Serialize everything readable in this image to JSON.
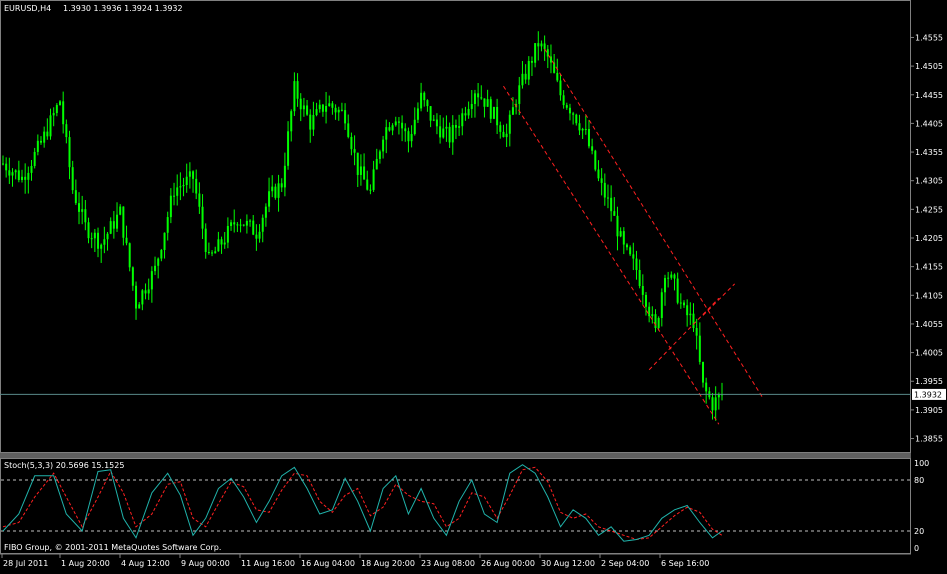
{
  "header": {
    "symbol": "EURUSD,H4",
    "ohlc": "1.3930 1.3936 1.3924 1.3932"
  },
  "indicator": {
    "label": "Stoch(5,3,3) 20.5696 15.1525",
    "levels_labels": [
      "100",
      "80",
      "20",
      "0"
    ],
    "main_color": "#20b2aa",
    "signal_color": "#ff2020"
  },
  "copyright": "FIBO Group, © 2001-2011 MetaQuotes Software Corp.",
  "current_price_label": "1.3932",
  "colors": {
    "background": "#000000",
    "candle": "#00ff00",
    "channel": "#ff2020",
    "grid_text": "#ffffff",
    "price_line": "#5a8a8a"
  },
  "chart_data": {
    "type": "candlestick",
    "symbol": "EURUSD",
    "timeframe": "H4",
    "ylim": [
      1.3835,
      1.4575
    ],
    "yticks": [
      "1.4555",
      "1.4505",
      "1.4455",
      "1.4405",
      "1.4355",
      "1.4305",
      "1.4255",
      "1.4205",
      "1.4155",
      "1.4105",
      "1.4055",
      "1.4005",
      "1.3955",
      "1.3905",
      "1.3855"
    ],
    "xticks": [
      "28 Jul 2011",
      "1 Aug 20:00",
      "4 Aug 12:00",
      "9 Aug 00:00",
      "11 Aug 16:00",
      "16 Aug 04:00",
      "18 Aug 20:00",
      "23 Aug 08:00",
      "26 Aug 00:00",
      "30 Aug 12:00",
      "2 Sep 04:00",
      "6 Sep 16:00"
    ],
    "current_price": 1.3932,
    "close_path": [
      [
        0,
        1.4335
      ],
      [
        6,
        1.431
      ],
      [
        12,
        1.437
      ],
      [
        18,
        1.4445
      ],
      [
        22,
        1.429
      ],
      [
        26,
        1.4225
      ],
      [
        31,
        1.4195
      ],
      [
        37,
        1.425
      ],
      [
        42,
        1.409
      ],
      [
        48,
        1.415
      ],
      [
        54,
        1.429
      ],
      [
        60,
        1.431
      ],
      [
        65,
        1.4165
      ],
      [
        70,
        1.4205
      ],
      [
        74,
        1.424
      ],
      [
        80,
        1.4215
      ],
      [
        84,
        1.4275
      ],
      [
        88,
        1.43
      ],
      [
        92,
        1.4465
      ],
      [
        97,
        1.4405
      ],
      [
        102,
        1.444
      ],
      [
        108,
        1.442
      ],
      [
        112,
        1.4325
      ],
      [
        116,
        1.4285
      ],
      [
        120,
        1.439
      ],
      [
        124,
        1.442
      ],
      [
        128,
        1.4375
      ],
      [
        132,
        1.445
      ],
      [
        136,
        1.4405
      ],
      [
        141,
        1.438
      ],
      [
        145,
        1.442
      ],
      [
        149,
        1.4465
      ],
      [
        152,
        1.4445
      ],
      [
        156,
        1.441
      ],
      [
        159,
        1.4385
      ],
      [
        162,
        1.445
      ],
      [
        166,
        1.4505
      ],
      [
        169,
        1.4545
      ],
      [
        172,
        1.452
      ],
      [
        176,
        1.4455
      ],
      [
        180,
        1.4425
      ],
      [
        184,
        1.4385
      ],
      [
        188,
        1.4305
      ],
      [
        192,
        1.4255
      ],
      [
        196,
        1.4185
      ],
      [
        200,
        1.415
      ],
      [
        203,
        1.41
      ],
      [
        206,
        1.404
      ],
      [
        209,
        1.415
      ],
      [
        212,
        1.412
      ],
      [
        215,
        1.4075
      ],
      [
        218,
        1.406
      ],
      [
        221,
        1.3945
      ],
      [
        224,
        1.3915
      ],
      [
        227,
        1.3932
      ]
    ],
    "channel_lines": [
      {
        "from": [
          158,
          1.447
        ],
        "to": [
          226,
          1.388
        ]
      },
      {
        "from": [
          171,
          1.4535
        ],
        "to": [
          240,
          1.3925
        ]
      },
      {
        "from": [
          204,
          1.3975
        ],
        "to": [
          226,
          1.41
        ]
      },
      {
        "from": [
          221,
          1.407
        ],
        "to": [
          231,
          1.4125
        ]
      }
    ],
    "stochastic": {
      "params": "5,3,3",
      "main_last": 20.5696,
      "signal_last": 15.1525,
      "levels": [
        80,
        20
      ],
      "ylim": [
        0,
        100
      ],
      "main_path": [
        [
          0,
          20
        ],
        [
          5,
          40
        ],
        [
          10,
          85
        ],
        [
          16,
          85
        ],
        [
          20,
          40
        ],
        [
          25,
          20
        ],
        [
          30,
          90
        ],
        [
          34,
          92
        ],
        [
          38,
          35
        ],
        [
          42,
          12
        ],
        [
          47,
          65
        ],
        [
          52,
          88
        ],
        [
          56,
          62
        ],
        [
          60,
          15
        ],
        [
          64,
          35
        ],
        [
          68,
          70
        ],
        [
          72,
          82
        ],
        [
          76,
          60
        ],
        [
          80,
          30
        ],
        [
          84,
          55
        ],
        [
          88,
          85
        ],
        [
          92,
          95
        ],
        [
          96,
          70
        ],
        [
          100,
          40
        ],
        [
          104,
          45
        ],
        [
          108,
          82
        ],
        [
          112,
          55
        ],
        [
          116,
          20
        ],
        [
          120,
          70
        ],
        [
          124,
          85
        ],
        [
          128,
          40
        ],
        [
          132,
          70
        ],
        [
          136,
          35
        ],
        [
          140,
          15
        ],
        [
          144,
          55
        ],
        [
          148,
          80
        ],
        [
          152,
          40
        ],
        [
          156,
          30
        ],
        [
          160,
          88
        ],
        [
          164,
          98
        ],
        [
          168,
          88
        ],
        [
          172,
          60
        ],
        [
          176,
          25
        ],
        [
          180,
          45
        ],
        [
          184,
          35
        ],
        [
          188,
          15
        ],
        [
          192,
          25
        ],
        [
          196,
          8
        ],
        [
          200,
          10
        ],
        [
          204,
          15
        ],
        [
          208,
          35
        ],
        [
          212,
          45
        ],
        [
          216,
          50
        ],
        [
          220,
          30
        ],
        [
          224,
          12
        ],
        [
          227,
          20
        ]
      ],
      "signal_path": [
        [
          0,
          25
        ],
        [
          5,
          30
        ],
        [
          10,
          60
        ],
        [
          16,
          88
        ],
        [
          20,
          60
        ],
        [
          25,
          25
        ],
        [
          30,
          60
        ],
        [
          34,
          90
        ],
        [
          38,
          65
        ],
        [
          42,
          25
        ],
        [
          47,
          40
        ],
        [
          52,
          75
        ],
        [
          56,
          78
        ],
        [
          60,
          35
        ],
        [
          64,
          25
        ],
        [
          68,
          52
        ],
        [
          72,
          78
        ],
        [
          76,
          72
        ],
        [
          80,
          45
        ],
        [
          84,
          42
        ],
        [
          88,
          68
        ],
        [
          92,
          88
        ],
        [
          96,
          85
        ],
        [
          100,
          55
        ],
        [
          104,
          42
        ],
        [
          108,
          62
        ],
        [
          112,
          70
        ],
        [
          116,
          38
        ],
        [
          120,
          48
        ],
        [
          124,
          75
        ],
        [
          128,
          62
        ],
        [
          132,
          55
        ],
        [
          136,
          52
        ],
        [
          140,
          25
        ],
        [
          144,
          35
        ],
        [
          148,
          65
        ],
        [
          152,
          60
        ],
        [
          156,
          35
        ],
        [
          160,
          62
        ],
        [
          164,
          92
        ],
        [
          168,
          95
        ],
        [
          172,
          78
        ],
        [
          176,
          42
        ],
        [
          180,
          35
        ],
        [
          184,
          40
        ],
        [
          188,
          25
        ],
        [
          192,
          20
        ],
        [
          196,
          15
        ],
        [
          200,
          10
        ],
        [
          204,
          12
        ],
        [
          208,
          25
        ],
        [
          212,
          38
        ],
        [
          216,
          48
        ],
        [
          220,
          42
        ],
        [
          224,
          22
        ],
        [
          227,
          15
        ]
      ]
    }
  }
}
